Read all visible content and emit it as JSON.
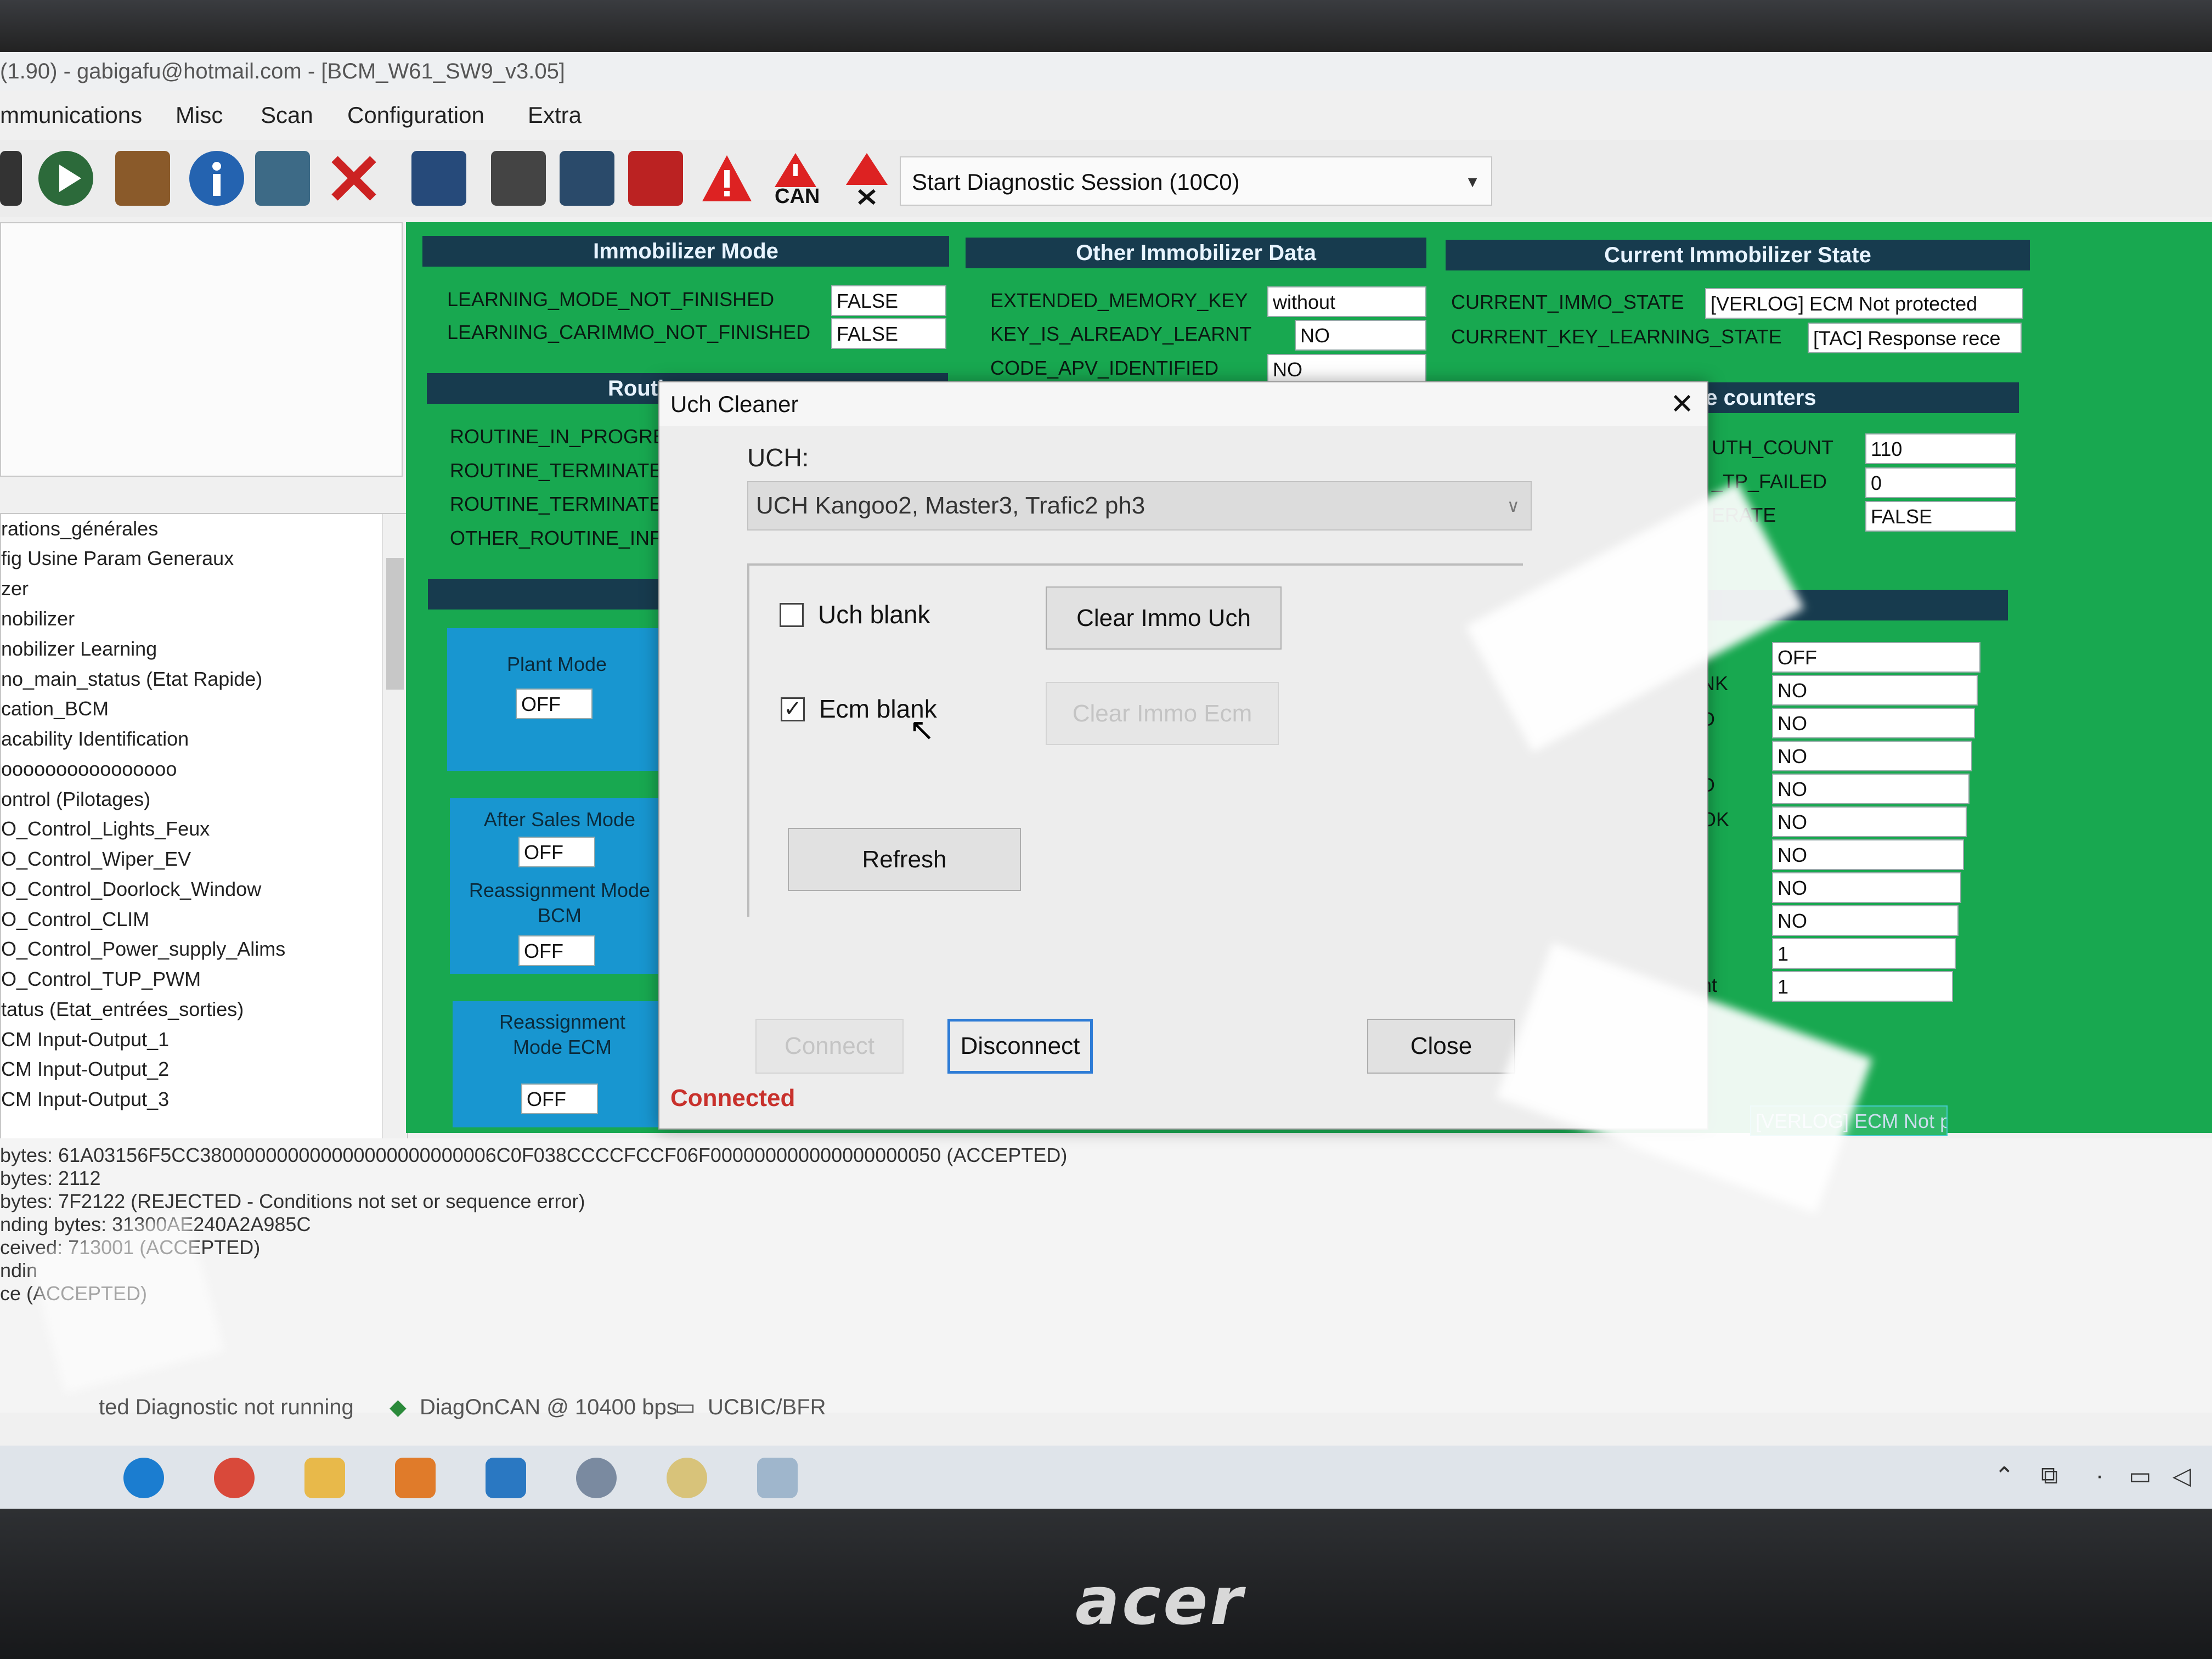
{
  "window": {
    "title": "(1.90) - gabigafu@hotmail.com - [BCM_W61_SW9_v3.05]"
  },
  "menu": [
    "mmunications",
    "Misc",
    "Scan",
    "Configuration",
    "Extra"
  ],
  "toolbar": {
    "can_label": "CAN",
    "session_select_value": "Start Diagnostic Session (10C0)"
  },
  "tree": {
    "items": [
      "rations_générales",
      "fig Usine Param Generaux",
      "zer",
      "nobilizer",
      "nobilizer Learning",
      "no_main_status (Etat Rapide)",
      "cation_BCM",
      "acability Identification",
      "oooooooooooooooo",
      "ontrol (Pilotages)",
      "O_Control_Lights_Feux",
      "O_Control_Wiper_EV",
      "O_Control_Doorlock_Window",
      "O_Control_CLIM",
      "O_Control_Power_supply_Alims",
      "O_Control_TUP_PWM",
      "tatus (Etat_entrées_sorties)",
      "CM Input-Output_1",
      "CM Input-Output_2",
      "CM Input-Output_3"
    ]
  },
  "immobilizer_mode": {
    "header": "Immobilizer Mode",
    "rows": [
      {
        "label": "LEARNING_MODE_NOT_FINISHED",
        "value": "FALSE"
      },
      {
        "label": "LEARNING_CARIMMO_NOT_FINISHED",
        "value": "FALSE"
      }
    ]
  },
  "other_immo": {
    "header": "Other Immobilizer Data",
    "rows": [
      {
        "label": "EXTENDED_MEMORY_KEY",
        "value": "without"
      },
      {
        "label": "KEY_IS_ALREADY_LEARNT",
        "value": "NO"
      },
      {
        "label": "CODE_APV_IDENTIFIED",
        "value": "NO"
      }
    ]
  },
  "current_state": {
    "header": "Current Immobilizer State",
    "rows": [
      {
        "label": "CURRENT_IMMO_STATE",
        "value": "[VERLOG] ECM Not protected"
      },
      {
        "label": "CURRENT_KEY_LEARNING_STATE",
        "value": "[TAC] Response rece"
      }
    ]
  },
  "routine": {
    "header": "Routi",
    "rows": [
      "ROUTINE_IN_PROGRES",
      "ROUTINE_TERMINATED",
      "ROUTINE_TERMINATED",
      "OTHER_ROUTINE_INFO"
    ]
  },
  "counters": {
    "header": "ent Mode counters",
    "rows": [
      {
        "label": "UTH_COUNT",
        "value": "110"
      },
      {
        "label": "_TP_FAILED",
        "value": "0"
      },
      {
        "label": "ERATE",
        "value": "FALSE"
      }
    ]
  },
  "right_values": {
    "labels": [
      "NK",
      "D",
      "D",
      "OK",
      "nt"
    ],
    "values": [
      "OFF",
      "NO",
      "NO",
      "NO",
      "NO",
      "NO",
      "NO",
      "NO",
      "NO",
      "1",
      "1"
    ],
    "verlog_partial": "[VERLOG] ECM Not pr"
  },
  "modes": {
    "plant": {
      "label": "Plant Mode",
      "value": "OFF"
    },
    "after_sales": {
      "label": "After Sales Mode",
      "value": "OFF"
    },
    "reassign_bcm": {
      "label": "Reassignment Mode BCM",
      "value": "OFF"
    },
    "reassign_ecm": {
      "label": "Reassignment Mode ECM",
      "value": "OFF"
    }
  },
  "log": {
    "lines": [
      "bytes: 61A03156F5CC380000000000000000000000006C0F038CCCCFCCF06F000000000000000000050 (ACCEPTED)",
      "bytes: 2112",
      "bytes: 7F2122 (REJECTED - Conditions not set or sequence error)",
      "nding bytes: 31300AE240A2A985C",
      "ceived: 713001 (ACCEPTED)",
      "ndin",
      "ce              (ACCEPTED)"
    ]
  },
  "statusbar": {
    "diag": "ted Diagnostic not running",
    "bus": "DiagOnCAN @ 10400 bps",
    "ucbic": "UCBIC/BFR"
  },
  "dialog": {
    "title": "Uch Cleaner",
    "uch_label": "UCH:",
    "uch_value": "UCH Kangoo2, Master3, Trafic2 ph3",
    "uch_blank_label": "Uch blank",
    "uch_blank_checked": false,
    "ecm_blank_label": "Ecm blank",
    "ecm_blank_checked": true,
    "clear_immo_uch": "Clear Immo Uch",
    "clear_immo_ecm": "Clear Immo Ecm",
    "refresh": "Refresh",
    "connect": "Connect",
    "disconnect": "Disconnect",
    "close": "Close",
    "status": "Connected"
  },
  "brand": {
    "logo": "acer"
  },
  "colors": {
    "panel_green": "#18a850",
    "section_header": "#173b4e",
    "mode_blue": "#1896d0",
    "status_red": "#c8312c",
    "focus_blue": "#2e7cd6"
  }
}
